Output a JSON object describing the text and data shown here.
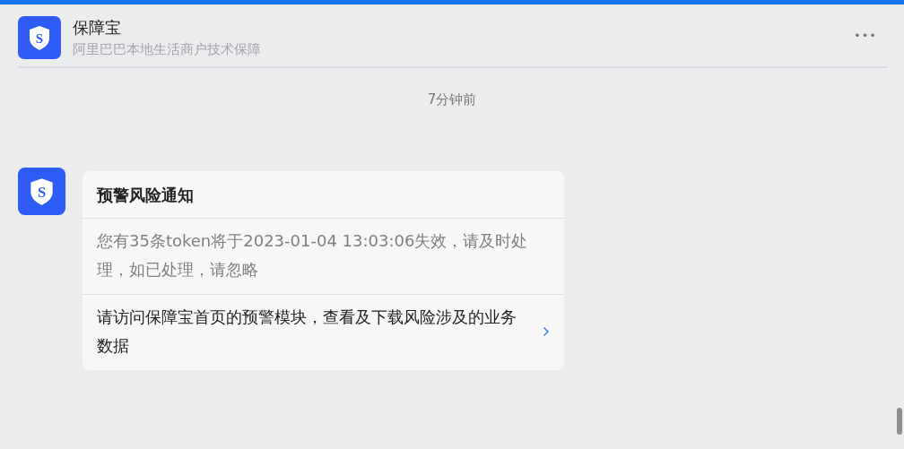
{
  "header": {
    "logo_letter": "S",
    "title": "保障宝",
    "subtitle": "阿里巴巴本地生活商户技术保障",
    "more": "•••"
  },
  "timestamp": "7分钟前",
  "message": {
    "avatar_letter": "S",
    "title": "预警风险通知",
    "body": "您有35条token将于2023-01-04 13:03:06失效，请及时处理，如已处理，请忽略",
    "link": "请访问保障宝首页的预警模块，查看及下载风险涉及的业务数据"
  }
}
